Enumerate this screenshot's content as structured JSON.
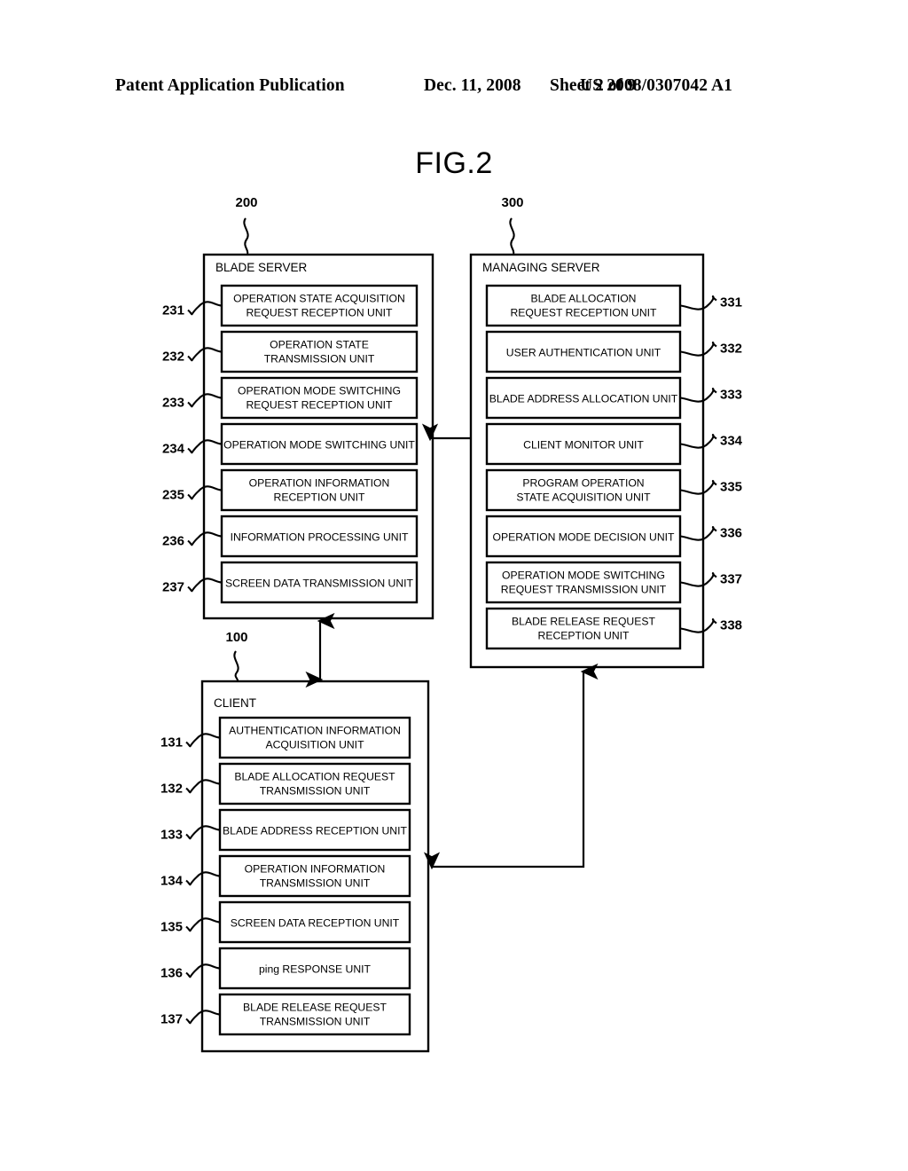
{
  "header": {
    "publication": "Patent Application Publication",
    "date": "Dec. 11, 2008",
    "sheet": "Sheet 2 of 9",
    "patent_number": "US 2008/0307042 A1"
  },
  "figure": {
    "title": "FIG.2"
  },
  "diagram": {
    "callouts": {
      "blade_server": "200",
      "managing_server": "300",
      "client": "100"
    },
    "blade_server": {
      "title": "BLADE SERVER",
      "units": [
        {
          "ref": "231",
          "label": "OPERATION STATE ACQUISITION REQUEST RECEPTION UNIT"
        },
        {
          "ref": "232",
          "label": "OPERATION STATE TRANSMISSION UNIT"
        },
        {
          "ref": "233",
          "label": "OPERATION MODE SWITCHING REQUEST RECEPTION UNIT"
        },
        {
          "ref": "234",
          "label": "OPERATION MODE SWITCHING UNIT"
        },
        {
          "ref": "235",
          "label": "OPERATION INFORMATION RECEPTION UNIT"
        },
        {
          "ref": "236",
          "label": "INFORMATION PROCESSING UNIT"
        },
        {
          "ref": "237",
          "label": "SCREEN DATA TRANSMISSION UNIT"
        }
      ]
    },
    "managing_server": {
      "title": "MANAGING SERVER",
      "units": [
        {
          "ref": "331",
          "label": "BLADE ALLOCATION REQUEST RECEPTION UNIT"
        },
        {
          "ref": "332",
          "label": "USER AUTHENTICATION UNIT"
        },
        {
          "ref": "333",
          "label": "BLADE ADDRESS ALLOCATION UNIT"
        },
        {
          "ref": "334",
          "label": "CLIENT MONITOR UNIT"
        },
        {
          "ref": "335",
          "label": "PROGRAM OPERATION STATE ACQUISITION UNIT"
        },
        {
          "ref": "336",
          "label": "OPERATION MODE DECISION UNIT"
        },
        {
          "ref": "337",
          "label": "OPERATION MODE SWITCHING REQUEST TRANSMISSION UNIT"
        },
        {
          "ref": "338",
          "label": "BLADE RELEASE REQUEST RECEPTION UNIT"
        }
      ]
    },
    "client": {
      "title": "CLIENT",
      "units": [
        {
          "ref": "131",
          "label": "AUTHENTICATION INFORMATION ACQUISITION UNIT"
        },
        {
          "ref": "132",
          "label": "BLADE ALLOCATION REQUEST TRANSMISSION UNIT"
        },
        {
          "ref": "133",
          "label": "BLADE ADDRESS RECEPTION UNIT"
        },
        {
          "ref": "134",
          "label": "OPERATION INFORMATION TRANSMISSION UNIT"
        },
        {
          "ref": "135",
          "label": "SCREEN DATA RECEPTION UNIT"
        },
        {
          "ref": "136",
          "label": "ping RESPONSE UNIT"
        },
        {
          "ref": "137",
          "label": "BLADE RELEASE REQUEST TRANSMISSION UNIT"
        }
      ]
    },
    "connectors": [
      {
        "name": "managing-server-to-blade-server",
        "direction": "one-way-left"
      },
      {
        "name": "blade-server-to-client",
        "direction": "two-way-vertical"
      },
      {
        "name": "client-to-managing-server",
        "direction": "two-way-elbow"
      }
    ]
  }
}
